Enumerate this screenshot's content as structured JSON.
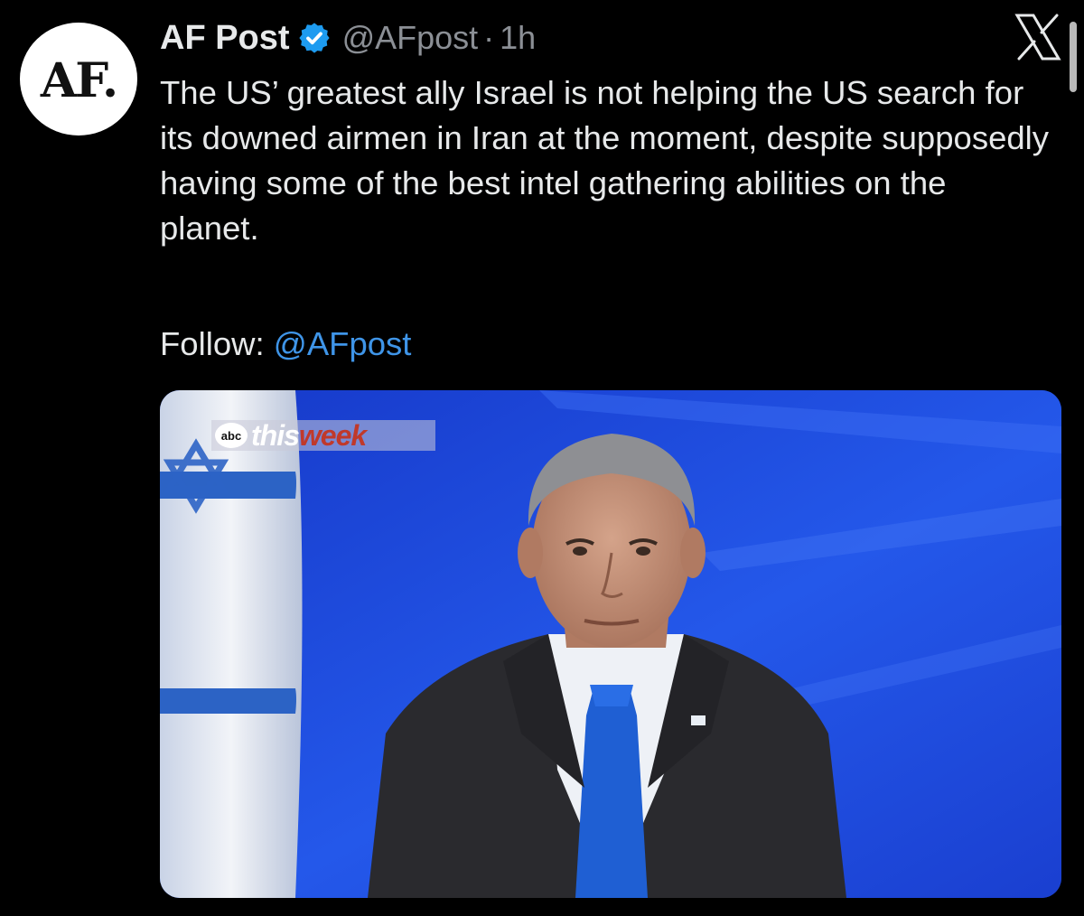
{
  "account": {
    "avatar_text": "AF.",
    "display_name": "AF Post",
    "handle": "@AFpost",
    "separator": "·",
    "time": "1h",
    "verified_icon": "verified-badge-icon"
  },
  "tweet": {
    "text": "The US’ greatest ally Israel is not helping the US search for its downed airmen in Iran at the moment, despite supposedly having some of the best intel gathering abilities on the planet.",
    "follow_label": "Follow: ",
    "follow_link": "@AFpost"
  },
  "media": {
    "watermark_network": "abc",
    "watermark_this": "this",
    "watermark_week": "week"
  },
  "icons": {
    "close": "x-logo-icon"
  },
  "colors": {
    "background": "#000000",
    "text": "#e7e9ea",
    "muted": "#8b8f95",
    "link": "#3f95e8",
    "verified": "#1d9bf0",
    "media_backdrop": "#1f4fe3"
  }
}
